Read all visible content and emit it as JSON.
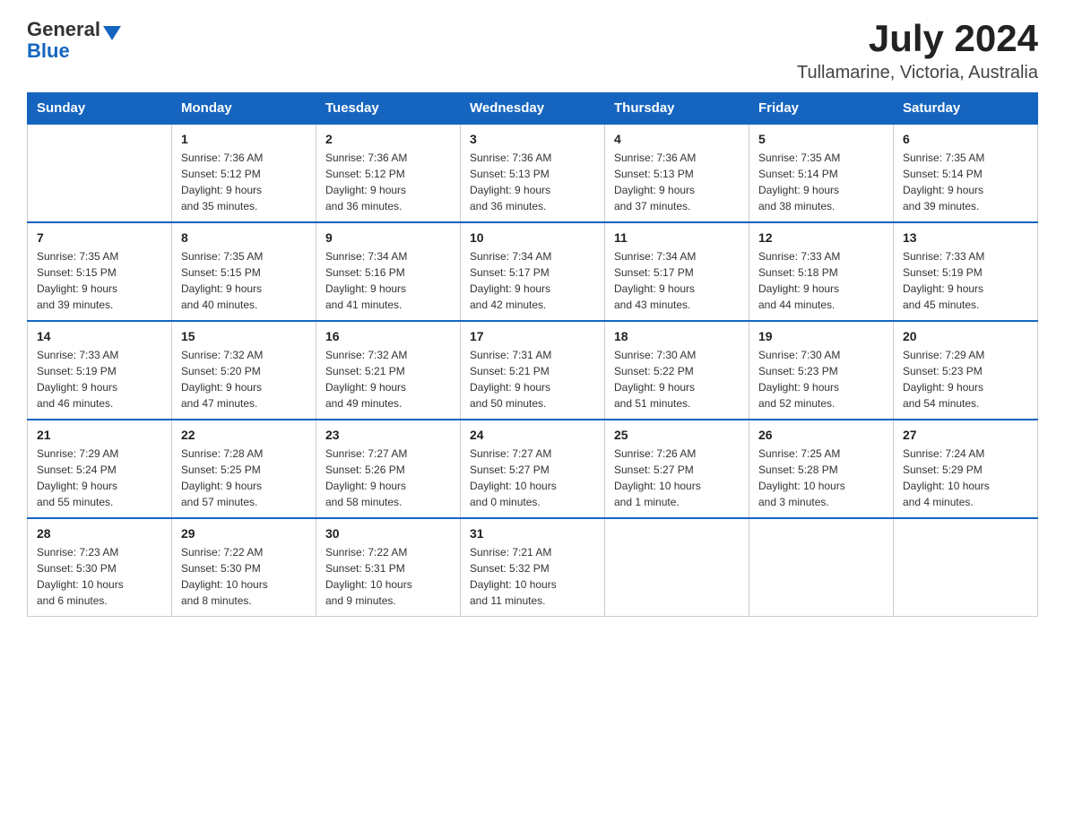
{
  "header": {
    "logo_general": "General",
    "logo_blue": "Blue",
    "month_year": "July 2024",
    "location": "Tullamarine, Victoria, Australia"
  },
  "calendar": {
    "weekdays": [
      "Sunday",
      "Monday",
      "Tuesday",
      "Wednesday",
      "Thursday",
      "Friday",
      "Saturday"
    ],
    "weeks": [
      [
        {
          "day": "",
          "info": ""
        },
        {
          "day": "1",
          "info": "Sunrise: 7:36 AM\nSunset: 5:12 PM\nDaylight: 9 hours\nand 35 minutes."
        },
        {
          "day": "2",
          "info": "Sunrise: 7:36 AM\nSunset: 5:12 PM\nDaylight: 9 hours\nand 36 minutes."
        },
        {
          "day": "3",
          "info": "Sunrise: 7:36 AM\nSunset: 5:13 PM\nDaylight: 9 hours\nand 36 minutes."
        },
        {
          "day": "4",
          "info": "Sunrise: 7:36 AM\nSunset: 5:13 PM\nDaylight: 9 hours\nand 37 minutes."
        },
        {
          "day": "5",
          "info": "Sunrise: 7:35 AM\nSunset: 5:14 PM\nDaylight: 9 hours\nand 38 minutes."
        },
        {
          "day": "6",
          "info": "Sunrise: 7:35 AM\nSunset: 5:14 PM\nDaylight: 9 hours\nand 39 minutes."
        }
      ],
      [
        {
          "day": "7",
          "info": "Sunrise: 7:35 AM\nSunset: 5:15 PM\nDaylight: 9 hours\nand 39 minutes."
        },
        {
          "day": "8",
          "info": "Sunrise: 7:35 AM\nSunset: 5:15 PM\nDaylight: 9 hours\nand 40 minutes."
        },
        {
          "day": "9",
          "info": "Sunrise: 7:34 AM\nSunset: 5:16 PM\nDaylight: 9 hours\nand 41 minutes."
        },
        {
          "day": "10",
          "info": "Sunrise: 7:34 AM\nSunset: 5:17 PM\nDaylight: 9 hours\nand 42 minutes."
        },
        {
          "day": "11",
          "info": "Sunrise: 7:34 AM\nSunset: 5:17 PM\nDaylight: 9 hours\nand 43 minutes."
        },
        {
          "day": "12",
          "info": "Sunrise: 7:33 AM\nSunset: 5:18 PM\nDaylight: 9 hours\nand 44 minutes."
        },
        {
          "day": "13",
          "info": "Sunrise: 7:33 AM\nSunset: 5:19 PM\nDaylight: 9 hours\nand 45 minutes."
        }
      ],
      [
        {
          "day": "14",
          "info": "Sunrise: 7:33 AM\nSunset: 5:19 PM\nDaylight: 9 hours\nand 46 minutes."
        },
        {
          "day": "15",
          "info": "Sunrise: 7:32 AM\nSunset: 5:20 PM\nDaylight: 9 hours\nand 47 minutes."
        },
        {
          "day": "16",
          "info": "Sunrise: 7:32 AM\nSunset: 5:21 PM\nDaylight: 9 hours\nand 49 minutes."
        },
        {
          "day": "17",
          "info": "Sunrise: 7:31 AM\nSunset: 5:21 PM\nDaylight: 9 hours\nand 50 minutes."
        },
        {
          "day": "18",
          "info": "Sunrise: 7:30 AM\nSunset: 5:22 PM\nDaylight: 9 hours\nand 51 minutes."
        },
        {
          "day": "19",
          "info": "Sunrise: 7:30 AM\nSunset: 5:23 PM\nDaylight: 9 hours\nand 52 minutes."
        },
        {
          "day": "20",
          "info": "Sunrise: 7:29 AM\nSunset: 5:23 PM\nDaylight: 9 hours\nand 54 minutes."
        }
      ],
      [
        {
          "day": "21",
          "info": "Sunrise: 7:29 AM\nSunset: 5:24 PM\nDaylight: 9 hours\nand 55 minutes."
        },
        {
          "day": "22",
          "info": "Sunrise: 7:28 AM\nSunset: 5:25 PM\nDaylight: 9 hours\nand 57 minutes."
        },
        {
          "day": "23",
          "info": "Sunrise: 7:27 AM\nSunset: 5:26 PM\nDaylight: 9 hours\nand 58 minutes."
        },
        {
          "day": "24",
          "info": "Sunrise: 7:27 AM\nSunset: 5:27 PM\nDaylight: 10 hours\nand 0 minutes."
        },
        {
          "day": "25",
          "info": "Sunrise: 7:26 AM\nSunset: 5:27 PM\nDaylight: 10 hours\nand 1 minute."
        },
        {
          "day": "26",
          "info": "Sunrise: 7:25 AM\nSunset: 5:28 PM\nDaylight: 10 hours\nand 3 minutes."
        },
        {
          "day": "27",
          "info": "Sunrise: 7:24 AM\nSunset: 5:29 PM\nDaylight: 10 hours\nand 4 minutes."
        }
      ],
      [
        {
          "day": "28",
          "info": "Sunrise: 7:23 AM\nSunset: 5:30 PM\nDaylight: 10 hours\nand 6 minutes."
        },
        {
          "day": "29",
          "info": "Sunrise: 7:22 AM\nSunset: 5:30 PM\nDaylight: 10 hours\nand 8 minutes."
        },
        {
          "day": "30",
          "info": "Sunrise: 7:22 AM\nSunset: 5:31 PM\nDaylight: 10 hours\nand 9 minutes."
        },
        {
          "day": "31",
          "info": "Sunrise: 7:21 AM\nSunset: 5:32 PM\nDaylight: 10 hours\nand 11 minutes."
        },
        {
          "day": "",
          "info": ""
        },
        {
          "day": "",
          "info": ""
        },
        {
          "day": "",
          "info": ""
        }
      ]
    ]
  }
}
